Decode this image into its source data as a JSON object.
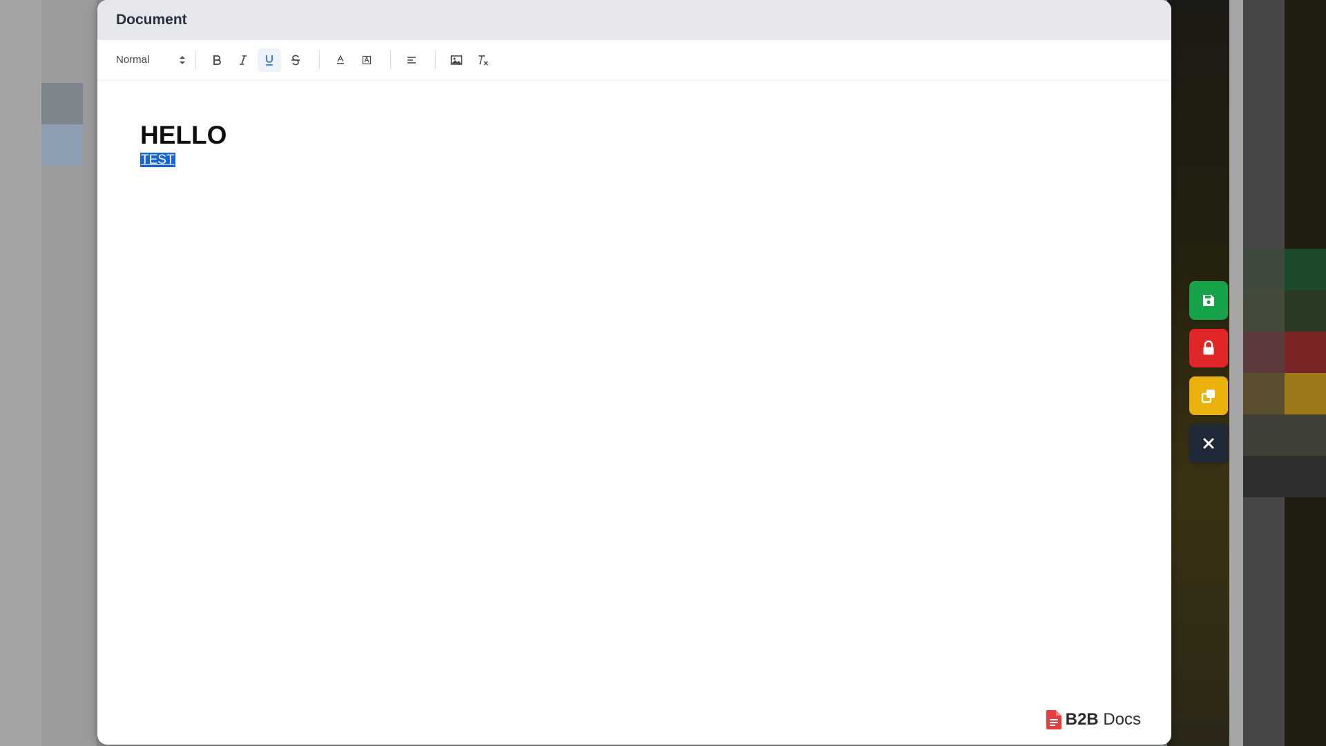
{
  "window": {
    "title": "Document"
  },
  "toolbar": {
    "format_select": {
      "value": "Normal",
      "icon": "up-down-arrows-icon"
    },
    "buttons": [
      {
        "name": "bold",
        "glyph": "B",
        "active": false
      },
      {
        "name": "italic",
        "glyph": "I",
        "active": false
      },
      {
        "name": "underline",
        "glyph": "U",
        "active": true
      },
      {
        "name": "strikethrough",
        "glyph": "S",
        "active": false
      },
      {
        "name": "text-color",
        "icon": "text-color-icon",
        "active": false
      },
      {
        "name": "background-color",
        "icon": "highlight-icon",
        "active": false
      },
      {
        "name": "align",
        "icon": "align-left-icon",
        "active": false
      },
      {
        "name": "image",
        "icon": "image-icon",
        "active": false
      },
      {
        "name": "clean-format",
        "icon": "clear-format-icon",
        "active": false
      }
    ]
  },
  "editor": {
    "heading": "HELLO",
    "selected_text": "TEST"
  },
  "brand": {
    "icon": "document-icon",
    "name_bold": "B2B",
    "name_rest": "Docs"
  },
  "actions": [
    {
      "name": "save",
      "icon": "floppy-disk-icon",
      "color": "#17a34a"
    },
    {
      "name": "lock",
      "icon": "lock-icon",
      "color": "#e02626"
    },
    {
      "name": "copy",
      "icon": "copy-icon",
      "color": "#e9b10a"
    },
    {
      "name": "close",
      "icon": "close-icon",
      "color": "#1f2937"
    }
  ],
  "colors": {
    "selection": "#1565d8",
    "header_bg": "#e5e7eb",
    "active_button": "#1f6fd1",
    "brand_icon": "#e53e3e"
  }
}
